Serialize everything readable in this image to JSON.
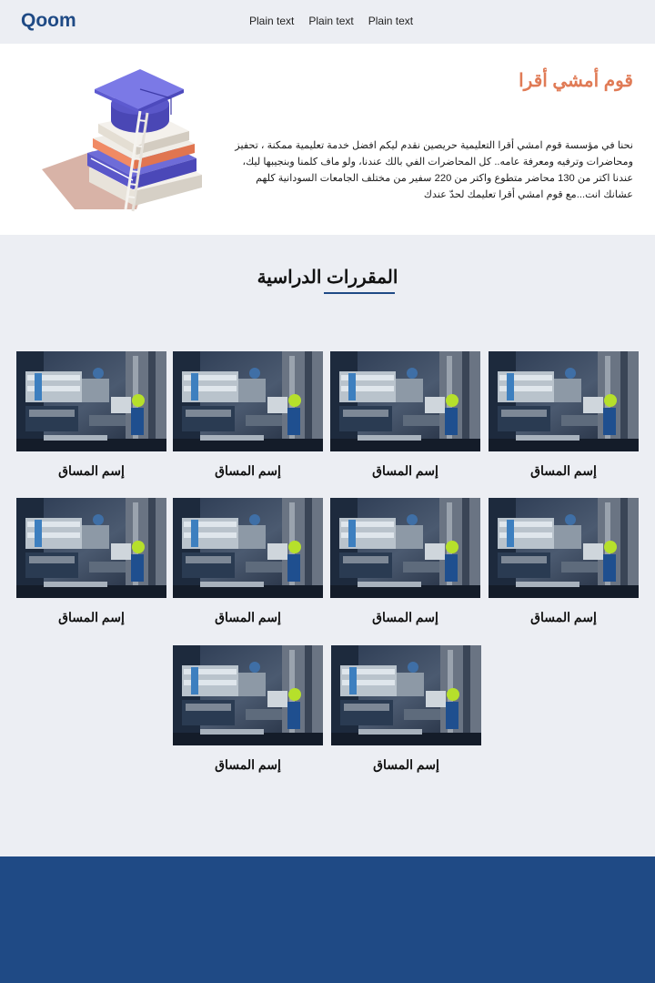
{
  "navbar": {
    "brand": "Qoom",
    "links": [
      "Plain text",
      "Plain text",
      "Plain text"
    ]
  },
  "hero": {
    "title": "قوم أمشي أقرا",
    "description": "نحنا في مؤسسة قوم امشي أقرا التعليمية حريصين نقدم ليكم افضل خدمة تعليمية ممكنة ، تحفيز ومحاضرات وترفيه ومعرفة عامه.. كل المحاضرات الفي بالك عندنا، ولو ماف كلمنا وبنجيبها ليك، عندنا اكتر من 130 محاضر متطوع واكتر من 220 سفير من مختلف الجامعات السودانية كلهم عشانك انت...مع قوم امشي أقرا تعليمك لحدّ عندك",
    "illustration_icon": "graduation-books-icon"
  },
  "courses": {
    "title": "المقررات الدراسية",
    "items": [
      {
        "label": "إسم المساق"
      },
      {
        "label": "إسم المساق"
      },
      {
        "label": "إسم المساق"
      },
      {
        "label": "إسم المساق"
      },
      {
        "label": "إسم المساق"
      },
      {
        "label": "إسم المساق"
      },
      {
        "label": "إسم المساق"
      },
      {
        "label": "إسم المساق"
      },
      {
        "label": "إسم المساق"
      },
      {
        "label": "إسم المساق"
      }
    ]
  },
  "colors": {
    "brand": "#1f4a85",
    "accent": "#e07b56",
    "background": "#eceef3",
    "footer": "#1f4a85"
  }
}
